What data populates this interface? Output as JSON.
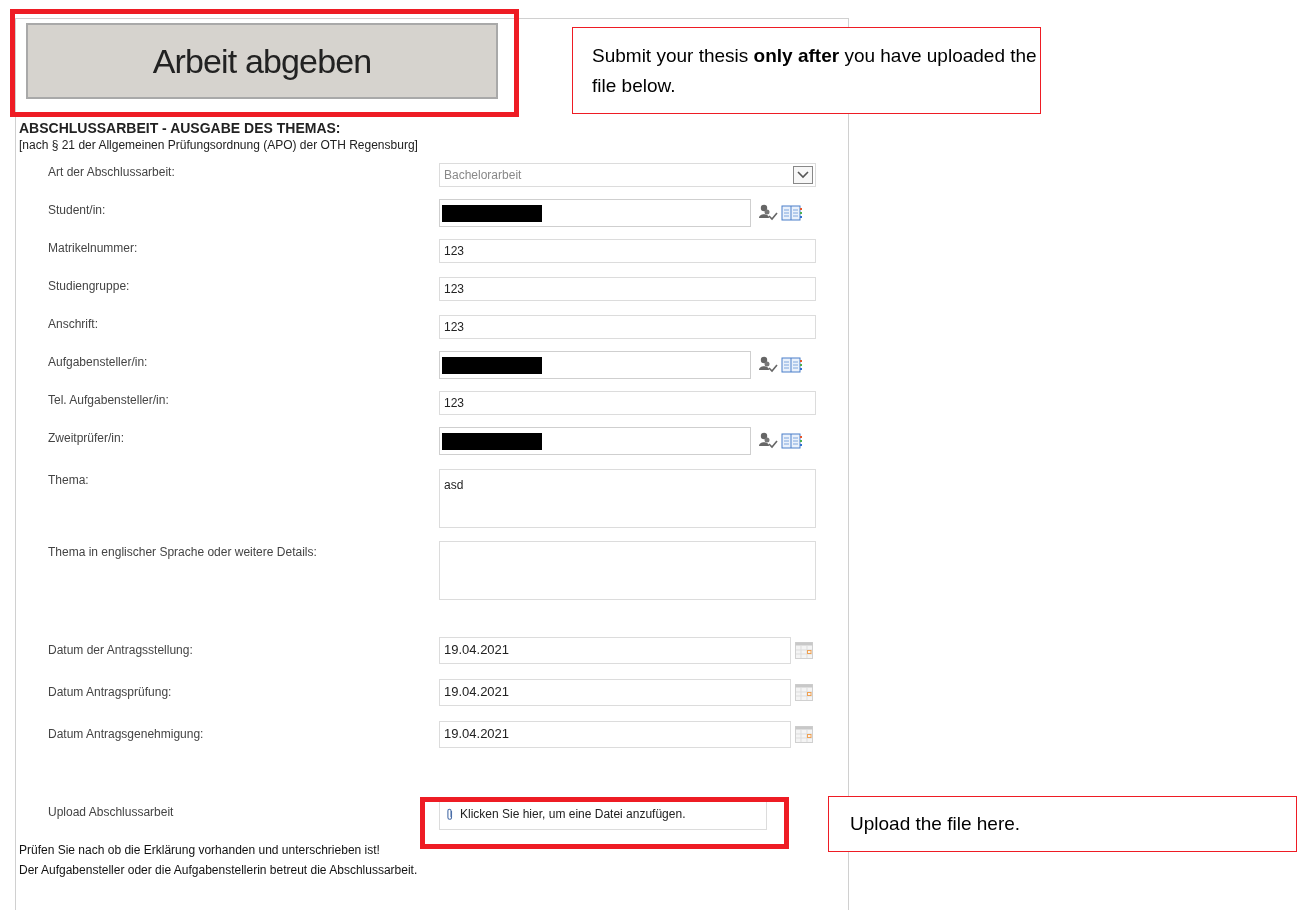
{
  "submit_button": {
    "label": "Arbeit abgeben"
  },
  "callouts": [
    {
      "text": "Submit your thesis **only after** you have uploaded the file below."
    },
    {
      "text": "Upload the file here."
    }
  ],
  "form": {
    "heading": "ABSCHLUSSARBEIT - AUSGABE DES THEMAS:",
    "subheading": "[nach § 21 der Allgemeinen Prüfungsordnung (APO) der OTH Regensburg]",
    "fields": [
      {
        "label": "Art der Abschlussarbeit:",
        "kind": "select",
        "value": "Bachelorarbeit"
      },
      {
        "label": "Student/in:",
        "kind": "person"
      },
      {
        "label": "Matrikelnummer:",
        "kind": "text",
        "value": "123"
      },
      {
        "label": "Studiengruppe:",
        "kind": "text",
        "value": "123"
      },
      {
        "label": "Anschrift:",
        "kind": "text",
        "value": "123"
      },
      {
        "label": "Aufgabensteller/in:",
        "kind": "person"
      },
      {
        "label": "Tel. Aufgabensteller/in:",
        "kind": "text",
        "value": "123"
      },
      {
        "label": "Zweitprüfer/in:",
        "kind": "person"
      },
      {
        "label": "Thema:",
        "kind": "textarea",
        "value": "asd"
      },
      {
        "label": "Thema in englischer Sprache oder weitere Details:",
        "kind": "textarea"
      },
      {
        "label": "Datum der Antragsstellung:",
        "kind": "date",
        "value": "19.04.2021"
      },
      {
        "label": "Datum Antragsprüfung:",
        "kind": "date",
        "value": "19.04.2021"
      },
      {
        "label": "Datum Antragsgenehmigung:",
        "kind": "date",
        "value": "19.04.2021"
      }
    ],
    "upload": {
      "label": "Upload Abschlussarbeit",
      "link": "Klicken Sie hier, um eine Datei anzufügen."
    },
    "notes": [
      "Prüfen Sie nach ob die Erklärung vorhanden und unterschrieben ist!",
      "Der Aufgabensteller oder die Aufgabenstellerin betreut die Abschlussarbeit."
    ]
  }
}
